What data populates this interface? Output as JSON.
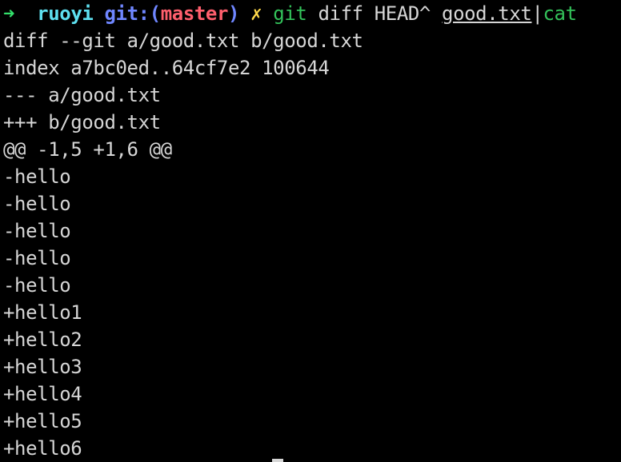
{
  "prompt": {
    "arrow": "➜",
    "directory": "ruoyi",
    "git_prefix": "git:(",
    "branch": "master",
    "git_suffix": ")",
    "dirty_marker": "✗",
    "command": "git",
    "args": " diff HEAD^ ",
    "file": "good.txt",
    "pipe": "|",
    "pipe_command": "cat"
  },
  "output_lines": [
    "diff --git a/good.txt b/good.txt",
    "index a7bc0ed..64cf7e2 100644",
    "--- a/good.txt",
    "+++ b/good.txt",
    "@@ -1,5 +1,6 @@",
    "-hello",
    "-hello",
    "-hello",
    "-hello",
    "-hello",
    "+hello1",
    "+hello2",
    "+hello3",
    "+hello4",
    "+hello5",
    "+hello6"
  ],
  "colors": {
    "background": "#000000",
    "text": "#d6d6d6",
    "arrow": "#33e06b",
    "directory": "#5ee0f0",
    "git_label": "#6f86ff",
    "branch": "#ff5f6d",
    "dirty": "#ffd94a",
    "command": "#33c25a"
  }
}
